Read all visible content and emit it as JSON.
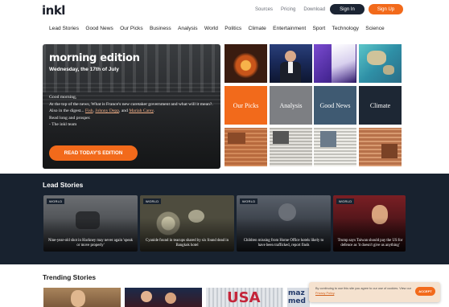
{
  "header": {
    "logo_text": "inkl",
    "links": [
      "Sources",
      "Pricing",
      "Download"
    ],
    "sign_in": "Sign In",
    "sign_up": "Sign Up"
  },
  "nav": {
    "items": [
      "Lead Stories",
      "Good News",
      "Our Picks",
      "Business",
      "Analysis",
      "World",
      "Politics",
      "Climate",
      "Entertainment",
      "Sport",
      "Technology",
      "Science"
    ]
  },
  "hero": {
    "title": "morning edition",
    "date": "Wednesday, the 17th of July",
    "greeting": "Good morning,",
    "line1": "At the top of the news, What is France's new caretaker government and what will it mean?.",
    "line2_prefix": "Also in the digest... ",
    "link1": "Fish",
    "link2": "Johnny Depp",
    "link3": "Mariah Carey",
    "sep1": ", ",
    "sep2": ", and ",
    "line2_suffix": ".",
    "line3": "Read long and prosper.",
    "line4": "- The inkl team",
    "button": "READ TODAY'S EDITION"
  },
  "tiles": {
    "labels": [
      "Our Picks",
      "Analysis",
      "Good News",
      "Climate"
    ],
    "colors": [
      "#f26a1b",
      "#7d7f83",
      "#3f5a72",
      "#1d2734"
    ]
  },
  "lead_stories": {
    "title": "Lead Stories",
    "tag": "WORLD",
    "cards": [
      "Nine-year-old shot in Hackney may never again 'speak or move properly'",
      "Cyanide found in teacups shared by six found dead in Bangkok hotel",
      "Children missing from Home Office hotels likely to have been trafficked, report finds",
      "Trump says Taiwan should pay the US for defence as 'it doesn't give us anything'"
    ]
  },
  "trending": {
    "title": "Trending Stories"
  },
  "cookie": {
    "text": "By continuing to use this site you agree to our use of cookies. View our ",
    "link": "Privacy Policy",
    "text_end": ".",
    "accept": "ACCEPT"
  },
  "colors": {
    "accent": "#f26a1b",
    "navy": "#18222f"
  }
}
